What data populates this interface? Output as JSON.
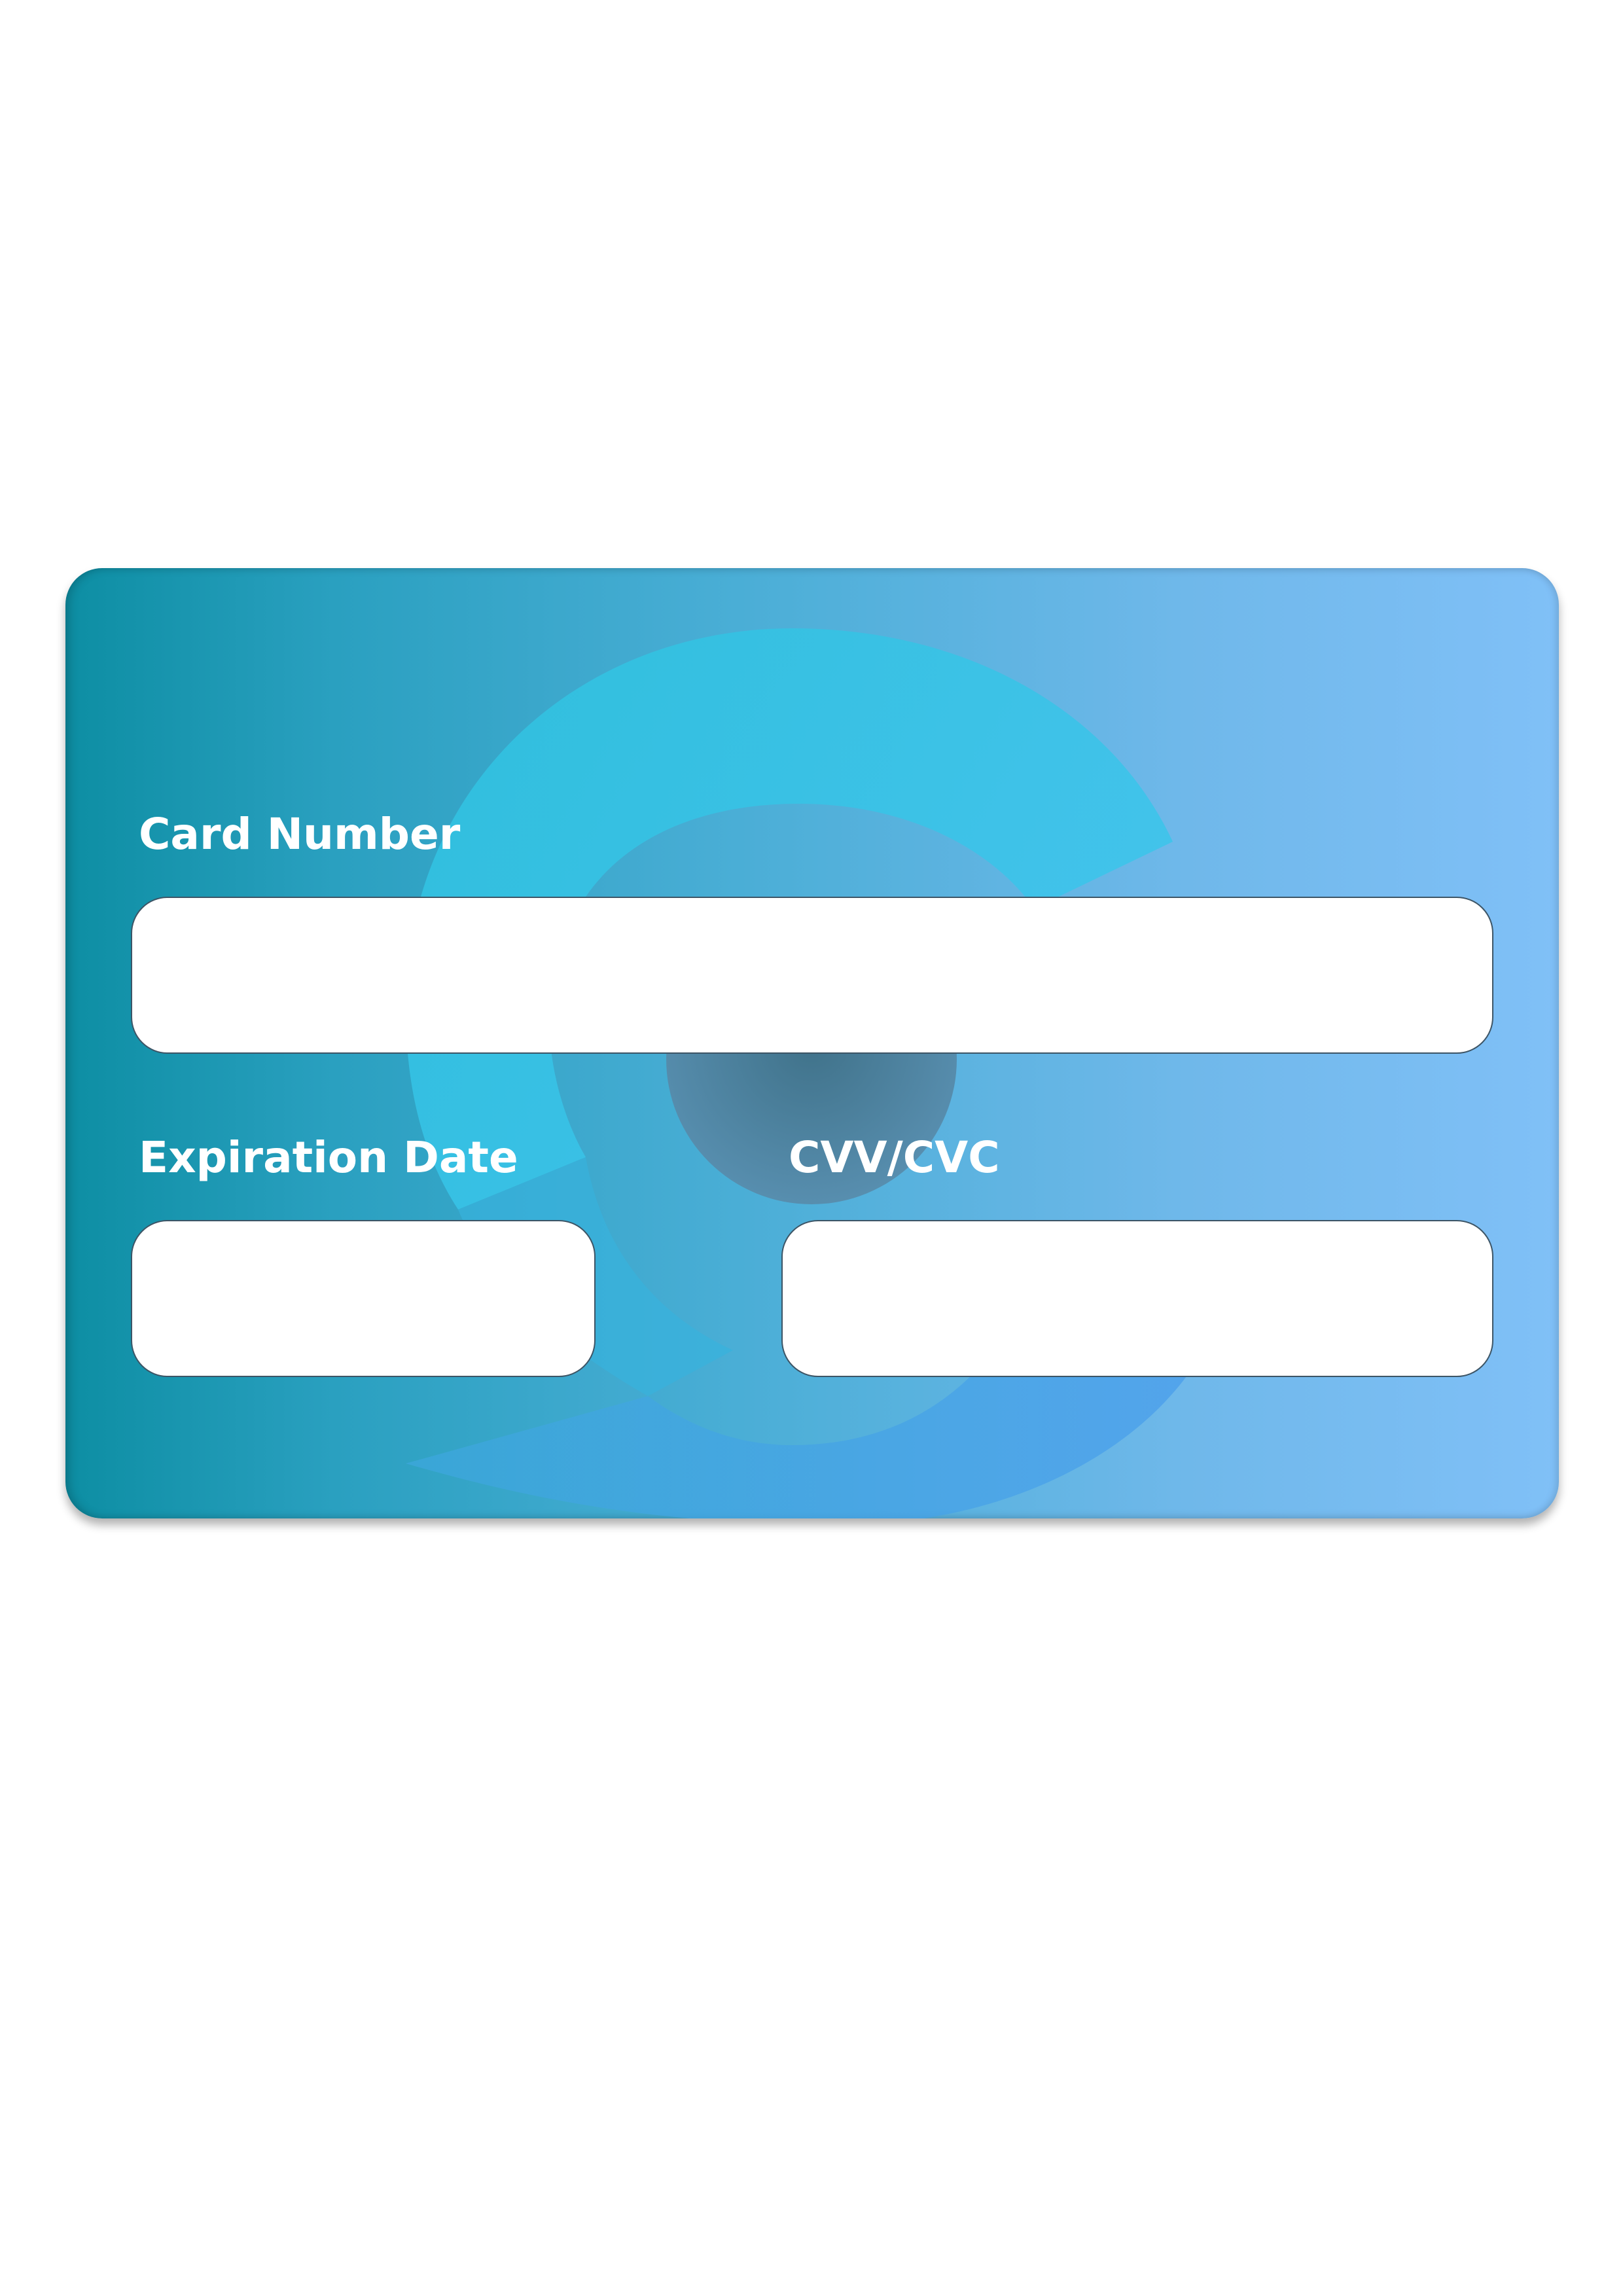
{
  "card": {
    "card_number": {
      "label": "Card Number",
      "value": "",
      "placeholder": ""
    },
    "expiration_date": {
      "label": "Expiration Date",
      "value": "",
      "placeholder": ""
    },
    "cvv": {
      "label": "CVV/CVC",
      "value": "",
      "placeholder": ""
    }
  },
  "colors": {
    "gradient_start": "#0d8ea3",
    "gradient_end": "#80c0f7",
    "logo_arc": "#3ec8ee",
    "logo_arc_lower": "#4aa2ea",
    "logo_center": "#4e7f9c",
    "field_background": "#ffffff",
    "field_border": "#3d5566",
    "label_text": "#ffffff"
  },
  "icons": {
    "watermark": "logo-watermark-icon"
  }
}
